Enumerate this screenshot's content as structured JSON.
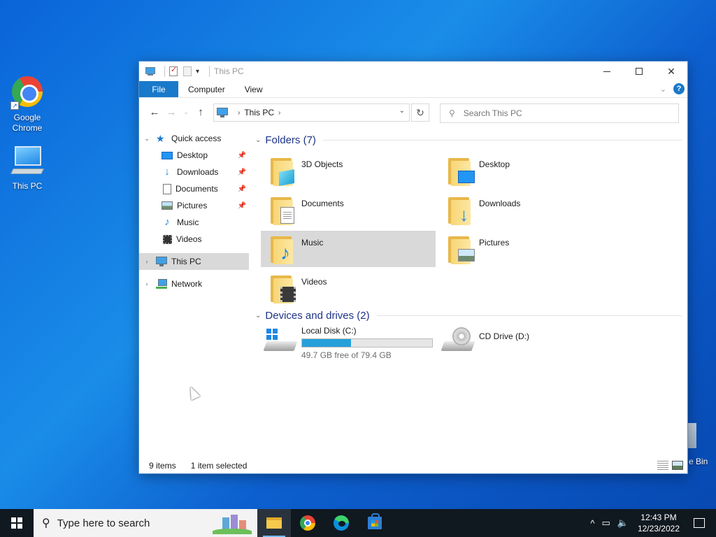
{
  "desktop": {
    "icons": [
      {
        "label": "Google Chrome",
        "icon": "chrome-icon"
      },
      {
        "label": "This PC",
        "icon": "computer-icon"
      }
    ],
    "recycle_bin_label": "e Bin"
  },
  "window": {
    "title": "This PC",
    "quick_access_toolbar": [
      "properties-icon",
      "new-folder-icon",
      "customize-dropdown-icon"
    ],
    "controls": {
      "minimize": "—",
      "maximize": "☐",
      "close": "✕"
    }
  },
  "ribbon": {
    "tabs": [
      {
        "label": "File",
        "active": true
      },
      {
        "label": "Computer"
      },
      {
        "label": "View"
      }
    ],
    "help": "?"
  },
  "navigation": {
    "back": "←",
    "forward": "→",
    "recent": "⌄",
    "up": "↑",
    "address": [
      "This PC"
    ],
    "refresh": "↻",
    "search_placeholder": "Search This PC"
  },
  "sidebar": {
    "quick_access": {
      "label": "Quick access",
      "items": [
        {
          "label": "Desktop",
          "icon": "desktop-icon",
          "pinned": true
        },
        {
          "label": "Downloads",
          "icon": "downloads-icon",
          "pinned": true
        },
        {
          "label": "Documents",
          "icon": "documents-icon",
          "pinned": true
        },
        {
          "label": "Pictures",
          "icon": "pictures-icon",
          "pinned": true
        },
        {
          "label": "Music",
          "icon": "music-icon",
          "pinned": false
        },
        {
          "label": "Videos",
          "icon": "videos-icon",
          "pinned": false
        }
      ]
    },
    "this_pc": {
      "label": "This PC",
      "selected": true
    },
    "network": {
      "label": "Network"
    }
  },
  "content": {
    "folders_header": "Folders (7)",
    "folders": [
      {
        "name": "3D Objects",
        "icon": "3d-objects-folder-icon"
      },
      {
        "name": "Desktop",
        "icon": "desktop-folder-icon"
      },
      {
        "name": "Documents",
        "icon": "documents-folder-icon"
      },
      {
        "name": "Downloads",
        "icon": "downloads-folder-icon"
      },
      {
        "name": "Music",
        "icon": "music-folder-icon",
        "selected": true
      },
      {
        "name": "Pictures",
        "icon": "pictures-folder-icon"
      },
      {
        "name": "Videos",
        "icon": "videos-folder-icon"
      }
    ],
    "drives_header": "Devices and drives (2)",
    "drives": [
      {
        "name": "Local Disk (C:)",
        "free_text": "49.7 GB free of 79.4 GB",
        "used_fraction": 0.374,
        "icon": "hard-disk-icon"
      },
      {
        "name": "CD Drive (D:)",
        "icon": "cd-drive-icon"
      }
    ]
  },
  "status": {
    "items": "9 items",
    "selected": "1 item selected"
  },
  "taskbar": {
    "search_placeholder": "Type here to search",
    "apps": [
      "file-explorer-icon",
      "chrome-icon",
      "edge-icon",
      "store-icon"
    ],
    "tray": {
      "chevron": "^",
      "time": "12:43 PM",
      "date": "12/23/2022"
    }
  },
  "colors": {
    "accent": "#1979ca",
    "drive_bar": "#26a0da",
    "selection": "#d9d9d9"
  }
}
